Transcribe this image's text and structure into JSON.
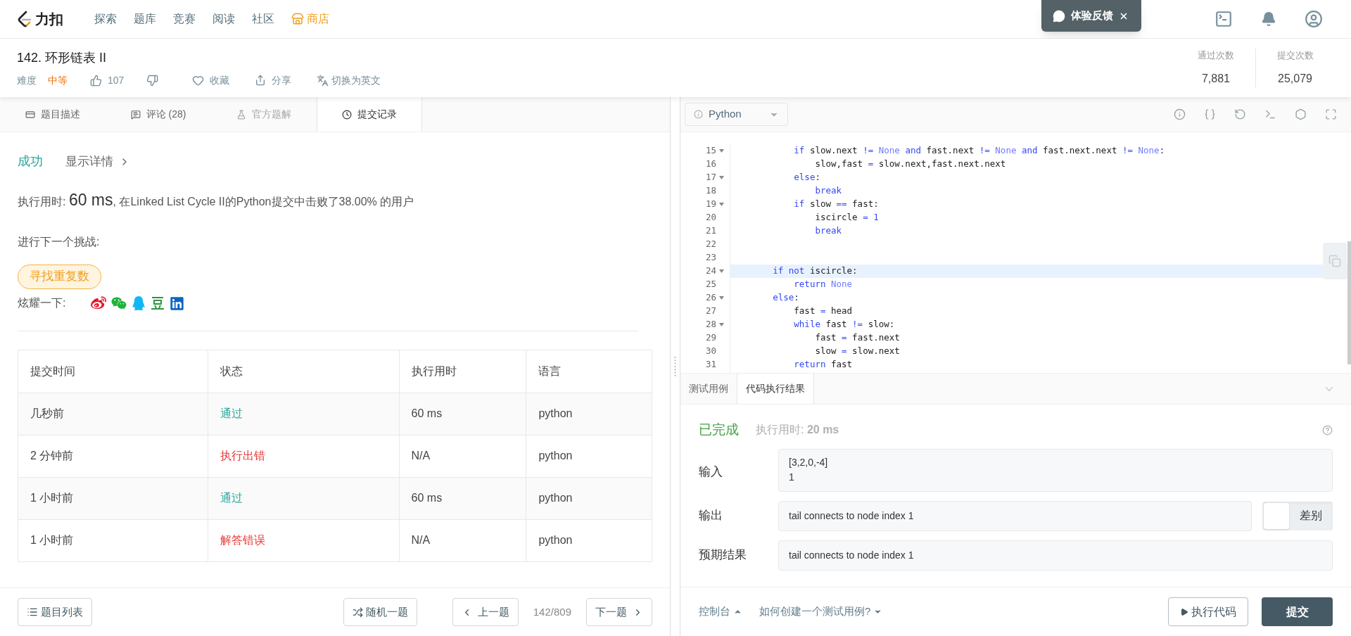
{
  "nav": {
    "logo_text": "力扣",
    "items": [
      {
        "label": "探索",
        "kind": "link"
      },
      {
        "label": "题库",
        "kind": "link"
      },
      {
        "label": "竞赛",
        "kind": "link"
      },
      {
        "label": "阅读",
        "kind": "link"
      },
      {
        "label": "社区",
        "kind": "link"
      },
      {
        "label": "商店",
        "kind": "shop"
      }
    ]
  },
  "feedback": {
    "label": "体验反馈"
  },
  "problem": {
    "title": "142. 环形链表 II",
    "difficulty_label": "难度",
    "difficulty": "中等",
    "likes": "107",
    "favorite": "收藏",
    "share": "分享",
    "translate": "切换为英文"
  },
  "stats": [
    {
      "label": "通过次数",
      "value": "7,881"
    },
    {
      "label": "提交次数",
      "value": "25,079"
    }
  ],
  "left_tabs": [
    {
      "label": "题目描述",
      "selected": false,
      "disabled": false
    },
    {
      "label": "评论 (28)",
      "selected": false,
      "disabled": false
    },
    {
      "label": "官方题解",
      "selected": false,
      "disabled": true
    },
    {
      "label": "提交记录",
      "selected": true,
      "disabled": false
    }
  ],
  "result": {
    "status": "成功",
    "details": "显示详情",
    "summary_prefix": "执行用时: ",
    "runtime": "60 ms",
    "summary_suffix": ", 在Linked List Cycle II的Python提交中击败了38.00% 的用户",
    "next_label": "进行下一个挑战:",
    "next_problem": "寻找重复数",
    "share_label": "炫耀一下:"
  },
  "table": {
    "columns": [
      "提交时间",
      "状态",
      "执行用时",
      "语言"
    ],
    "rows": [
      {
        "time": "几秒前",
        "status": "通过",
        "color": "#26a69a",
        "runtime": "60 ms",
        "language": "python"
      },
      {
        "time": "2 分钟前",
        "status": "执行出错",
        "color": "#e53935",
        "runtime": "N/A",
        "language": "python"
      },
      {
        "time": "1 小时前",
        "status": "通过",
        "color": "#26a69a",
        "runtime": "60 ms",
        "language": "python"
      },
      {
        "time": "1 小时前",
        "status": "解答错误",
        "color": "#e53935",
        "runtime": "N/A",
        "language": "python"
      }
    ]
  },
  "left_footer": {
    "list": "题目列表",
    "random": "随机一题",
    "prev": "上一题",
    "position": "142/809",
    "next": "下一题"
  },
  "editor": {
    "language": "Python",
    "lines": [
      {
        "n": "15",
        "fold": true,
        "active": false,
        "tokens": [
          {
            "t": "            if",
            "kind": "kw"
          },
          {
            "t": " slow.next ",
            "kind": "plain"
          },
          {
            "t": "!= ",
            "kind": "op"
          },
          {
            "t": "None ",
            "kind": "const"
          },
          {
            "t": "and",
            "kind": "kw"
          },
          {
            "t": " fast.next ",
            "kind": "plain"
          },
          {
            "t": "!= ",
            "kind": "op"
          },
          {
            "t": "None ",
            "kind": "const"
          },
          {
            "t": "and",
            "kind": "kw"
          },
          {
            "t": " fast.next.next ",
            "kind": "plain"
          },
          {
            "t": "!= ",
            "kind": "op"
          },
          {
            "t": "None",
            "kind": "const"
          },
          {
            "t": ":",
            "kind": "plain"
          }
        ]
      },
      {
        "n": "16",
        "fold": false,
        "active": false,
        "tokens": [
          {
            "t": "                slow,fast ",
            "kind": "plain"
          },
          {
            "t": "= ",
            "kind": "op"
          },
          {
            "t": "slow.next,fast.next.next",
            "kind": "plain"
          }
        ]
      },
      {
        "n": "17",
        "fold": true,
        "active": false,
        "tokens": [
          {
            "t": "            else",
            "kind": "kw"
          },
          {
            "t": ":",
            "kind": "plain"
          }
        ]
      },
      {
        "n": "18",
        "fold": false,
        "active": false,
        "tokens": [
          {
            "t": "                break",
            "kind": "kw"
          }
        ]
      },
      {
        "n": "19",
        "fold": true,
        "active": false,
        "tokens": [
          {
            "t": "            if",
            "kind": "kw"
          },
          {
            "t": " slow ",
            "kind": "plain"
          },
          {
            "t": "== ",
            "kind": "op"
          },
          {
            "t": "fast:",
            "kind": "plain"
          }
        ]
      },
      {
        "n": "20",
        "fold": false,
        "active": false,
        "tokens": [
          {
            "t": "                iscircle ",
            "kind": "plain"
          },
          {
            "t": "= 1",
            "kind": "op"
          }
        ]
      },
      {
        "n": "21",
        "fold": false,
        "active": false,
        "tokens": [
          {
            "t": "                break",
            "kind": "kw"
          }
        ]
      },
      {
        "n": "22",
        "fold": false,
        "active": false
      },
      {
        "n": "23",
        "fold": false,
        "active": false
      },
      {
        "n": "24",
        "fold": true,
        "active": true,
        "tokens": [
          {
            "t": "        if not",
            "kind": "kw"
          },
          {
            "t": " iscircle:",
            "kind": "plain"
          }
        ]
      },
      {
        "n": "25",
        "fold": false,
        "active": false,
        "tokens": [
          {
            "t": "            return ",
            "kind": "kw"
          },
          {
            "t": "None",
            "kind": "const"
          }
        ]
      },
      {
        "n": "26",
        "fold": true,
        "active": false,
        "tokens": [
          {
            "t": "        else",
            "kind": "kw"
          },
          {
            "t": ":",
            "kind": "plain"
          }
        ]
      },
      {
        "n": "27",
        "fold": false,
        "active": false,
        "tokens": [
          {
            "t": "            fast ",
            "kind": "plain"
          },
          {
            "t": "= ",
            "kind": "op"
          },
          {
            "t": "head",
            "kind": "plain"
          }
        ]
      },
      {
        "n": "28",
        "fold": true,
        "active": false,
        "tokens": [
          {
            "t": "            while",
            "kind": "kw"
          },
          {
            "t": " fast ",
            "kind": "plain"
          },
          {
            "t": "!= ",
            "kind": "op"
          },
          {
            "t": "slow:",
            "kind": "plain"
          }
        ]
      },
      {
        "n": "29",
        "fold": false,
        "active": false,
        "tokens": [
          {
            "t": "                fast ",
            "kind": "plain"
          },
          {
            "t": "= ",
            "kind": "op"
          },
          {
            "t": "fast.next",
            "kind": "plain"
          }
        ]
      },
      {
        "n": "30",
        "fold": false,
        "active": false,
        "tokens": [
          {
            "t": "                slow ",
            "kind": "plain"
          },
          {
            "t": "= ",
            "kind": "op"
          },
          {
            "t": "slow.next",
            "kind": "plain"
          }
        ]
      },
      {
        "n": "31",
        "fold": false,
        "active": false,
        "tokens": [
          {
            "t": "            return",
            "kind": "kw"
          },
          {
            "t": " fast",
            "kind": "plain"
          }
        ]
      }
    ]
  },
  "console_tabs": [
    {
      "label": "测试用例",
      "selected": false
    },
    {
      "label": "代码执行结果",
      "selected": true
    }
  ],
  "run_result": {
    "status": "已完成",
    "runtime_label": "执行用时: ",
    "runtime": "20 ms",
    "input_label": "输入",
    "input_lines": [
      "[3,2,0,-4]",
      "1"
    ],
    "output_label": "输出",
    "output": "tail connects to node index 1",
    "diff_label": "差别",
    "diff_on": false,
    "expected_label": "预期结果",
    "expected": "tail connects to node index 1"
  },
  "right_footer": {
    "console": "控制台",
    "howto": "如何创建一个测试用例?",
    "run": "执行代码",
    "submit": "提交"
  }
}
